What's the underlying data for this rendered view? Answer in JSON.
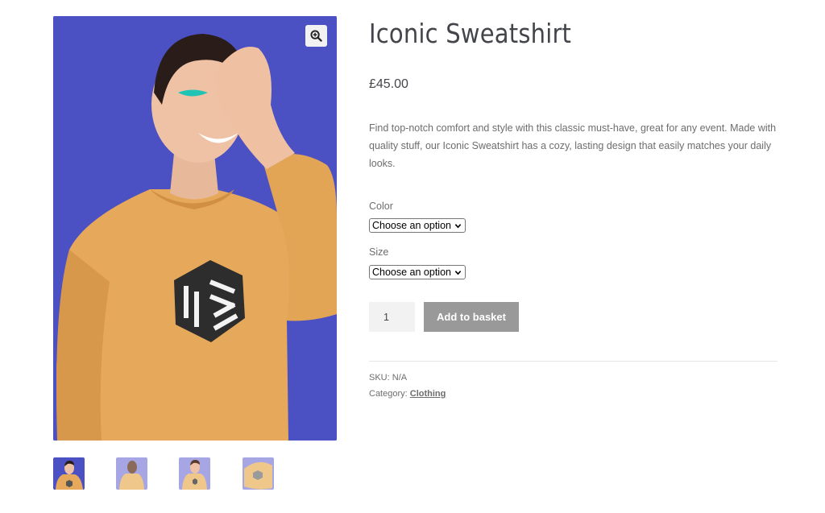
{
  "product": {
    "title": "Iconic Sweatshirt",
    "price": "£45.00",
    "description": "Find top-notch comfort and style with this classic must-have, great for any event. Made with quality stuff, our Iconic Sweatshirt has a cozy, lasting design that easily matches your daily looks."
  },
  "variations": {
    "color_label": "Color",
    "color_value": "Choose an option",
    "size_label": "Size",
    "size_value": "Choose an option"
  },
  "cart": {
    "quantity": "1",
    "add_label": "Add to basket"
  },
  "meta": {
    "sku_label": "SKU:",
    "sku_value": "N/A",
    "category_label": "Category:",
    "category_value": "Clothing"
  },
  "gallery": {
    "zoom_icon": "magnifier-zoom-icon",
    "thumbnails": [
      "front-blue",
      "back-lavender",
      "front-lavender",
      "detail-lavender"
    ]
  },
  "colors": {
    "image_bg": "#4b50c3",
    "sweatshirt": "#e6a85a",
    "button_bg": "#999999",
    "title": "#43454b"
  }
}
